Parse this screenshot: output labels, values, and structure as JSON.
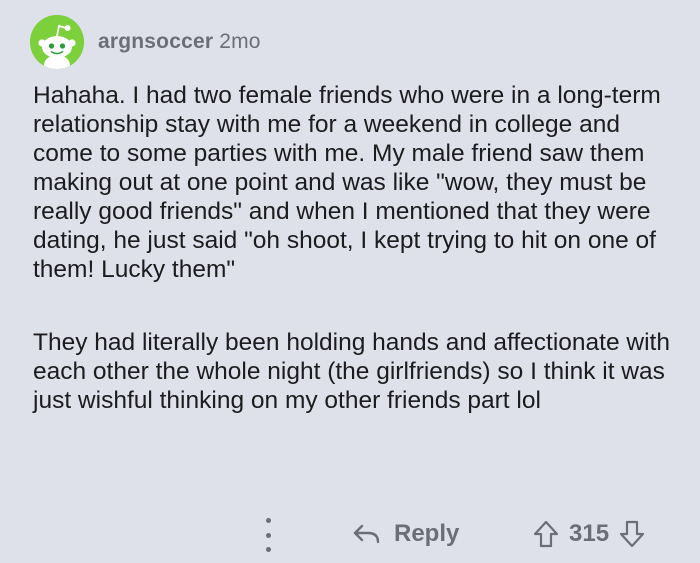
{
  "comment": {
    "username": "argnsoccer",
    "age": "2mo",
    "paragraphs": [
      "Hahaha. I had two female friends who were in a long-term relationship stay with me for a weekend in college and come to some parties with me. My male friend saw them making out at one point and was like \"wow, they must be really good friends\" and when I mentioned that they were dating, he just said \"oh shoot, I kept trying to hit on one of them! Lucky them\"",
      "They had literally been holding hands and affectionate with each other the whole night (the girlfriends) so I think it was just wishful thinking on my other friends part lol"
    ]
  },
  "actions": {
    "reply_label": "Reply",
    "vote_count": "315"
  },
  "colors": {
    "background": "#dfe1ea",
    "avatar": "#7bd03b",
    "meta_text": "#6b6e76",
    "body_text": "#1c1c1e"
  },
  "icons": {
    "avatar": "snoo-avatar-icon",
    "more": "more-options-icon",
    "reply": "reply-arrow-icon",
    "upvote": "upvote-arrow-icon",
    "downvote": "downvote-arrow-icon"
  }
}
